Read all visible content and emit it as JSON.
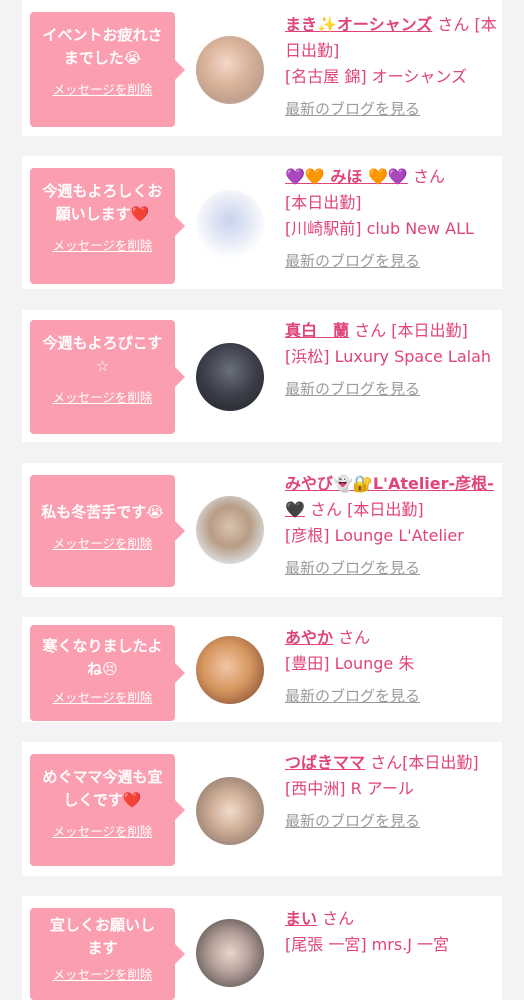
{
  "delete_label": "メッセージを削除",
  "blog_label": "最新のブログを見る",
  "san_label": "さん",
  "colors": {
    "accent": "#e0447a",
    "bubble": "#fb9fb0",
    "link_gray": "#9a9a9a"
  },
  "items": [
    {
      "message": "イベントお疲れさまでした😭",
      "name": "まき✨オーシャンズ",
      "status": "[本日出勤]",
      "shop": "[名古屋 錦] オーシャンズ"
    },
    {
      "message": "今週もよろしくお願いします❤️",
      "name": "💜🧡 みほ 🧡💜",
      "status": "[本日出勤]",
      "shop": "[川崎駅前] club New ALL"
    },
    {
      "message": "今週もよろぴこす☆",
      "name": "真白　蘭",
      "status": "[本日出勤]",
      "shop": "[浜松] Luxury Space Lalah"
    },
    {
      "message": "私も冬苦手です😭",
      "name": "みやび👻🔐L'Atelier-彦根-🖤",
      "status": "[本日出勤]",
      "shop": "[彦根] Lounge L'Atelier"
    },
    {
      "message": "寒くなりましたよね😣",
      "name": "あやか",
      "status": "",
      "shop": "[豊田] Lounge 朱"
    },
    {
      "message": "めぐママ今週も宜しくです❤️",
      "name": "つばきママ",
      "status": "[本日出勤]",
      "shop": "[西中洲] R アール"
    },
    {
      "message": "宜しくお願いします",
      "name": "まい",
      "status": "",
      "shop": "[尾張 一宮] mrs.J 一宮"
    }
  ]
}
